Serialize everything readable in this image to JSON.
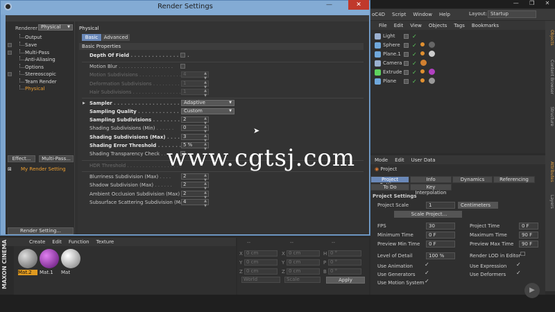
{
  "app": {
    "window_controls": [
      "—",
      "❐",
      "✕"
    ],
    "menu": [
      "oC4D",
      "Script",
      "Window",
      "Help"
    ],
    "layout_label": "Layout:",
    "layout_value": "Startup"
  },
  "object_manager": {
    "menu": [
      "File",
      "Edit",
      "View",
      "Objects",
      "Tags",
      "Bookmarks"
    ],
    "objects": [
      {
        "name": "Light",
        "icon_color": "#9ab0d0"
      },
      {
        "name": "Sphere",
        "icon_color": "#6fa8dc"
      },
      {
        "name": "Plane.1",
        "icon_color": "#6fa8dc"
      },
      {
        "name": "Camera",
        "icon_color": "#9ab0d0"
      },
      {
        "name": "Extrude",
        "icon_color": "#5fd35f"
      },
      {
        "name": "Plane",
        "icon_color": "#6fa8dc"
      }
    ]
  },
  "right_tabs": [
    "Objects",
    "Content Browser",
    "Structure",
    "Attributes",
    "Layers"
  ],
  "attributes": {
    "menu": [
      "Mode",
      "Edit",
      "User Data"
    ],
    "heading": "Project",
    "tabs": [
      "Project Settings",
      "Info",
      "Dynamics",
      "Referencing",
      "To Do",
      "Key Interpolation"
    ],
    "section": "Project Settings",
    "project_scale_label": "Project Scale",
    "project_scale_value": "1",
    "project_scale_unit": "Centimeters",
    "scale_button": "Scale Project...",
    "fps_label": "FPS",
    "fps": "30",
    "project_time_label": "Project Time",
    "project_time": "0 F",
    "min_time_label": "Minimum Time",
    "min_time": "0 F",
    "max_time_label": "Maximum Time",
    "max_time": "90 F",
    "prev_min_label": "Preview Min Time",
    "prev_min": "0 F",
    "prev_max_label": "Preview Max Time",
    "prev_max": "90 F",
    "lod_label": "Level of Detail",
    "lod": "100 %",
    "render_lod_label": "Render LOD in Editor",
    "use_animation": "Use Animation",
    "use_expression": "Use Expression",
    "use_generators": "Use Generators",
    "use_deformers": "Use Deformers",
    "use_motion": "Use Motion System"
  },
  "materials": {
    "menu": [
      "Create",
      "Edit",
      "Function",
      "Texture"
    ],
    "items": [
      {
        "name": "Mat.2",
        "color": "#9a9a9a"
      },
      {
        "name": "Mat.1",
        "color": "#b040c0"
      },
      {
        "name": "Mat",
        "color": "#d0d0d0"
      }
    ],
    "brand": "MAXON CINEMA"
  },
  "coords": {
    "header": [
      "--",
      "--",
      "--"
    ],
    "rows": [
      {
        "a": "X",
        "av": "0 cm",
        "b": "X",
        "bv": "0 cm",
        "c": "H",
        "cv": "0 °"
      },
      {
        "a": "Y",
        "av": "0 cm",
        "b": "Y",
        "bv": "0 cm",
        "c": "P",
        "cv": "0 °"
      },
      {
        "a": "Z",
        "av": "0 cm",
        "b": "Z",
        "bv": "0 cm",
        "c": "B",
        "cv": "0 °"
      }
    ],
    "world": "World",
    "scale": "Scale",
    "apply": "Apply"
  },
  "render_settings": {
    "title": "Render Settings",
    "renderer_label": "Renderer",
    "renderer_value": "Physical",
    "tree": [
      {
        "label": "Output",
        "cb": false
      },
      {
        "label": "Save",
        "cb": true
      },
      {
        "label": "Multi-Pass",
        "cb": true
      },
      {
        "label": "Anti-Aliasing",
        "cb": false
      },
      {
        "label": "Options",
        "cb": false
      },
      {
        "label": "Stereoscopic",
        "cb": true
      },
      {
        "label": "Team Render",
        "cb": false
      },
      {
        "label": "Physical",
        "cb": false
      }
    ],
    "effect_button": "Effect...",
    "multipass_button": "Multi-Pass...",
    "my_setting": "My Render Setting",
    "render_setting_button": "Render Setting...",
    "panel_title": "Physical",
    "tab_basic": "Basic",
    "tab_advanced": "Advanced",
    "section_basic": "Basic Properties",
    "dof": "Depth Of Field",
    "motion_blur": "Motion Blur",
    "motion_subdiv": "Motion Subdivisions",
    "motion_subdiv_v": "4",
    "deform_subdiv": "Deformation Subdivisions",
    "deform_subdiv_v": "1",
    "hair_subdiv": "Hair Subdivisions",
    "hair_subdiv_v": "1",
    "sampler": "Sampler",
    "sampler_v": "Adaptive",
    "sampling_quality": "Sampling Quality",
    "sampling_quality_v": "Custom",
    "sampling_subdiv": "Sampling Subdivisions",
    "sampling_subdiv_v": "2",
    "shading_min": "Shading Subdivisions (Min)",
    "shading_min_v": "0",
    "shading_max": "Shading Subdivisions (Max)",
    "shading_max_v": "3",
    "shading_err": "Shading Error Threshold",
    "shading_err_v": "5 %",
    "shading_trans": "Shading Transparency Check",
    "hdr": "HDR Threshold",
    "blurriness": "Blurriness Subdivision (Max)",
    "blurriness_v": "2",
    "shadow": "Shadow Subdivision (Max)",
    "shadow_v": "2",
    "ao": "Ambient Occlusion Subdivision (Max)",
    "ao_v": "2",
    "sss": "Subsurface Scattering Subdivision (Max)",
    "sss_v": "4"
  },
  "watermark": "www.cgtsj.com",
  "colors": {
    "accent": "#6a88b8",
    "title_bar": "#83abd4",
    "highlight": "#f0a030",
    "close": "#c0392b"
  }
}
